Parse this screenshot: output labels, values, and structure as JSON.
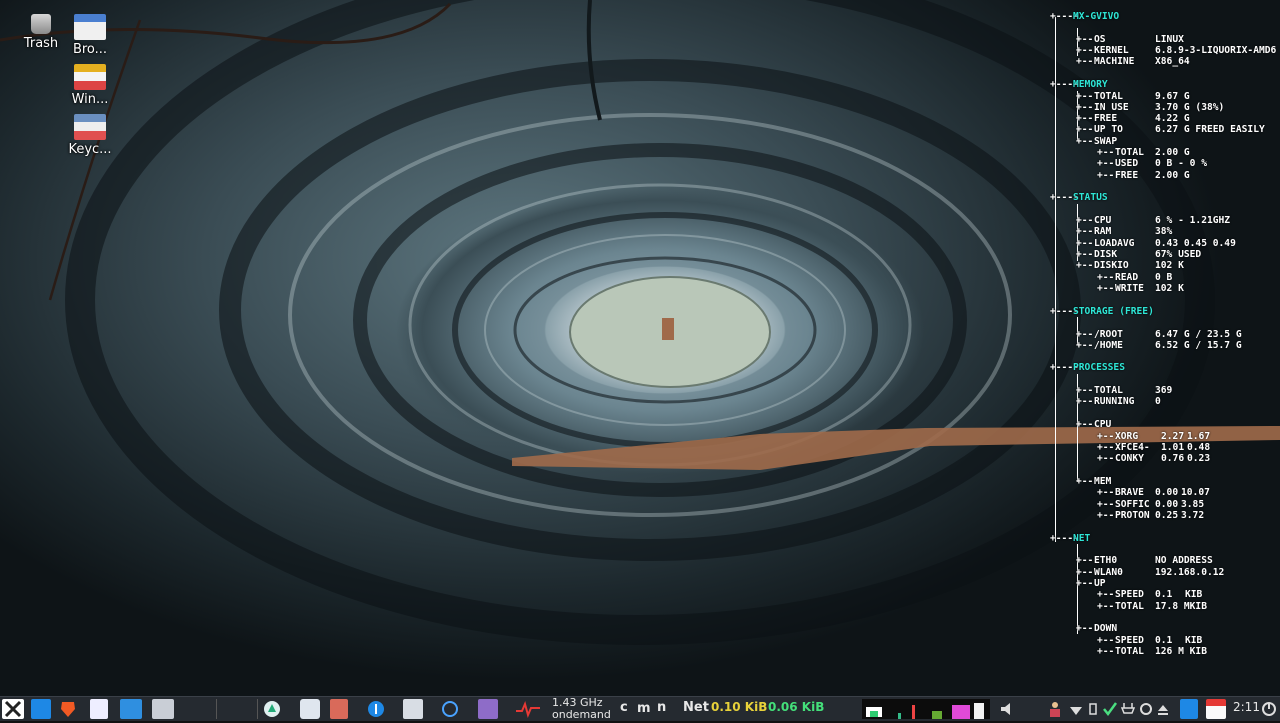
{
  "desktop_icons": [
    {
      "label": "Trash",
      "icon": "trash-icon"
    },
    {
      "label": "Bro...",
      "icon": "browser-icon"
    },
    {
      "label": "Win...",
      "icon": "window-icon"
    },
    {
      "label": "Keyc...",
      "icon": "keyboard-icon"
    }
  ],
  "conky": {
    "host": "MX-GVIVO",
    "system": {
      "os_k": "OS",
      "os_v": "LINUX",
      "kernel_k": "KERNEL",
      "kernel_v": "6.8.9-3-LIQUORIX-AMD6",
      "machine_k": "MACHINE",
      "machine_v": "X86_64"
    },
    "memory": {
      "title": "MEMORY",
      "total_k": "TOTAL",
      "total_v": "9.67 G",
      "inuse_k": "IN USE",
      "inuse_v": "3.70 G (38%)",
      "free_k": "FREE",
      "free_v": "4.22 G",
      "upto_k": "UP TO",
      "upto_v": "6.27 G FREED EASILY",
      "swap_k": "SWAP",
      "swap_total_k": "TOTAL",
      "swap_total_v": "2.00 G",
      "swap_used_k": "USED",
      "swap_used_v": "0 B   - 0 %",
      "swap_free_k": "FREE",
      "swap_free_v": "2.00 G"
    },
    "status": {
      "title": "STATUS",
      "cpu_k": "CPU",
      "cpu_v": "6 % - 1.21GHZ",
      "ram_k": "RAM",
      "ram_v": "38%",
      "load_k": "LOADAVG",
      "load_v": "0.43 0.45 0.49",
      "disk_k": "DISK",
      "disk_v": "67% USED",
      "diskio_k": "DISKIO",
      "diskio_v": "102 K",
      "read_k": "READ",
      "read_v": "0 B",
      "write_k": "WRITE",
      "write_v": "102 K"
    },
    "storage": {
      "title": "STORAGE (FREE)",
      "root_k": "/ROOT",
      "root_v": "6.47 G / 23.5 G",
      "home_k": "/HOME",
      "home_v": "6.52 G / 15.7 G"
    },
    "processes": {
      "title": "PROCESSES",
      "total_k": "TOTAL",
      "total_v": "369",
      "running_k": "RUNNING",
      "running_v": "0",
      "cpu_k": "CPU",
      "cpu_list": [
        {
          "name": "XORG",
          "a": "2.27",
          "b": "1.67"
        },
        {
          "name": "XFCE4-",
          "a": "1.01",
          "b": "0.48"
        },
        {
          "name": "CONKY",
          "a": "0.76",
          "b": "0.23"
        }
      ],
      "mem_k": "MEM",
      "mem_list": [
        {
          "name": "BRAVE",
          "a": "0.00",
          "b": "10.07"
        },
        {
          "name": "SOFFIC",
          "a": "0.00",
          "b": "3.85"
        },
        {
          "name": "PROTON",
          "a": "0.25",
          "b": "3.72"
        }
      ]
    },
    "net": {
      "title": "NET",
      "eth_k": "ETH0",
      "eth_v": "NO ADDRESS",
      "wlan_k": "WLAN0",
      "wlan_v": "192.168.0.12",
      "up_k": "UP",
      "up_speed_k": "SPEED",
      "up_speed_v": "0.1",
      "up_speed_u": "KIB",
      "up_total_k": "TOTAL",
      "up_total_v": "17.8 MKIB",
      "down_k": "DOWN",
      "down_speed_k": "SPEED",
      "down_speed_v": "0.1",
      "down_speed_u": "KIB",
      "down_total_k": "TOTAL",
      "down_total_v": "126 M KIB"
    }
  },
  "taskbar": {
    "cpu_freq": "1.43 GHz",
    "cpu_governor": "ondemand",
    "net_label": "Net",
    "net_up": "0.10 KiB",
    "net_down": "0.06 KiB",
    "clock": "2:11",
    "kbd_c": "c",
    "kbd_m": "m",
    "kbd_n": "n"
  },
  "colors": {
    "conky_section": "#2ee6d6",
    "net_up": "#e8d23a",
    "net_down": "#44e07a",
    "panel": "#252a30"
  }
}
